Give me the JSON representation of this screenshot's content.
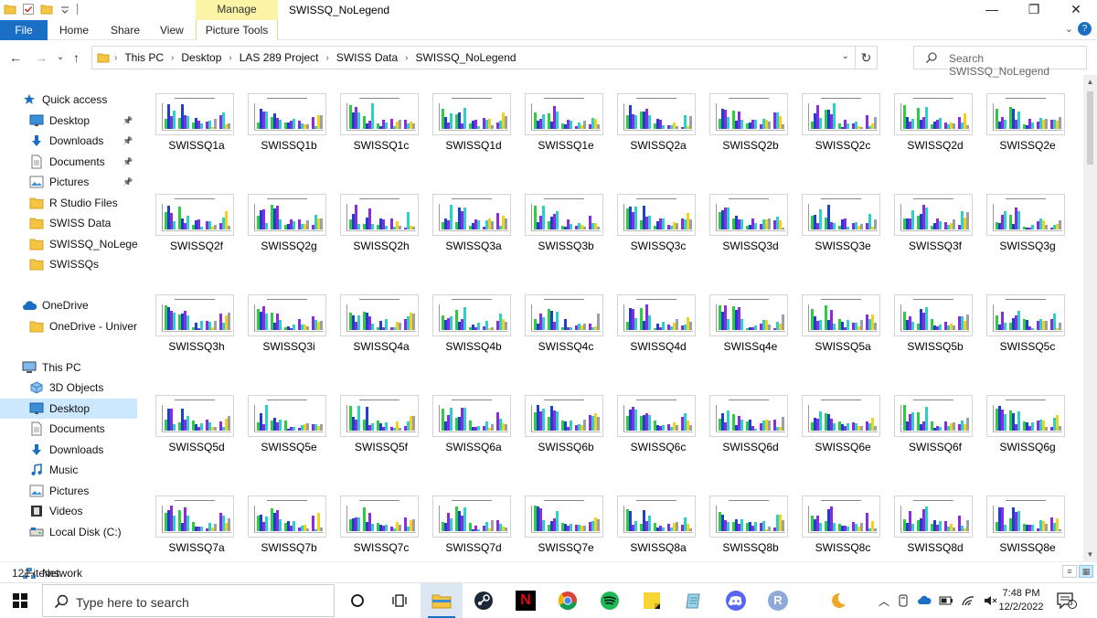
{
  "window": {
    "title": "SWISSQ_NoLegend",
    "context_tab": "Manage",
    "controls": {
      "minimize": "—",
      "maximize": "❐",
      "close": "✕"
    }
  },
  "ribbon": {
    "tabs": [
      "File",
      "Home",
      "Share",
      "View",
      "Picture Tools"
    ],
    "expand": "⌄",
    "help": "?"
  },
  "nav": {
    "back": "←",
    "forward": "→",
    "recent": "⌄",
    "up": "↑",
    "breadcrumb": [
      "This PC",
      "Desktop",
      "LAS 289 Project",
      "SWISS Data",
      "SWISSQ_NoLegend"
    ],
    "separator": "›",
    "dropdown": "⌄",
    "refresh": "↻"
  },
  "search": {
    "placeholder": "Search SWISSQ_NoLegend"
  },
  "sidebar": {
    "items": [
      {
        "label": "Quick access",
        "icon": "star-icon",
        "level": 0,
        "pinned": false,
        "selected": false
      },
      {
        "label": "Desktop",
        "icon": "desktop-icon",
        "level": 1,
        "pinned": true,
        "selected": false
      },
      {
        "label": "Downloads",
        "icon": "download-arrow-icon",
        "level": 1,
        "pinned": true,
        "selected": false
      },
      {
        "label": "Documents",
        "icon": "documents-icon",
        "level": 1,
        "pinned": true,
        "selected": false
      },
      {
        "label": "Pictures",
        "icon": "pictures-icon",
        "level": 1,
        "pinned": true,
        "selected": false
      },
      {
        "label": "R Studio Files",
        "icon": "folder-icon",
        "level": 1,
        "pinned": false,
        "selected": false
      },
      {
        "label": "SWISS Data",
        "icon": "folder-icon",
        "level": 1,
        "pinned": false,
        "selected": false
      },
      {
        "label": "SWISSQ_NoLegend",
        "icon": "folder-icon",
        "level": 1,
        "pinned": false,
        "selected": false
      },
      {
        "label": "SWISSQs",
        "icon": "folder-icon",
        "level": 1,
        "pinned": false,
        "selected": false
      },
      {
        "label": "OneDrive",
        "icon": "cloud-icon",
        "level": 0,
        "pinned": false,
        "selected": false
      },
      {
        "label": "OneDrive - Universi",
        "icon": "folder-icon",
        "level": 1,
        "pinned": false,
        "selected": false
      },
      {
        "label": "This PC",
        "icon": "computer-icon",
        "level": 0,
        "pinned": false,
        "selected": false
      },
      {
        "label": "3D Objects",
        "icon": "cube-icon",
        "level": 1,
        "pinned": false,
        "selected": false
      },
      {
        "label": "Desktop",
        "icon": "desktop-icon",
        "level": 1,
        "pinned": false,
        "selected": true
      },
      {
        "label": "Documents",
        "icon": "documents-icon",
        "level": 1,
        "pinned": false,
        "selected": false
      },
      {
        "label": "Downloads",
        "icon": "download-arrow-icon",
        "level": 1,
        "pinned": false,
        "selected": false
      },
      {
        "label": "Music",
        "icon": "music-note-icon",
        "level": 1,
        "pinned": false,
        "selected": false
      },
      {
        "label": "Pictures",
        "icon": "pictures-icon",
        "level": 1,
        "pinned": false,
        "selected": false
      },
      {
        "label": "Videos",
        "icon": "film-icon",
        "level": 1,
        "pinned": false,
        "selected": false
      },
      {
        "label": "Local Disk (C:)",
        "icon": "drive-icon",
        "level": 1,
        "pinned": false,
        "selected": false
      },
      {
        "label": "Network",
        "icon": "network-icon",
        "level": 0,
        "pinned": false,
        "selected": false
      }
    ]
  },
  "files": [
    "SWISSQ1a",
    "SWISSQ1b",
    "SWISSQ1c",
    "SWISSQ1d",
    "SWISSQ1e",
    "SWISSQ2a",
    "SWISSQ2b",
    "SWISSQ2c",
    "SWISSQ2d",
    "SWISSQ2e",
    "SWISSQ2f",
    "SWISSQ2g",
    "SWISSQ2h",
    "SWISSQ3a",
    "SWISSQ3b",
    "SWISSQ3c",
    "SWISSQ3d",
    "SWISSQ3e",
    "SWISSQ3f",
    "SWISSQ3g",
    "SWISSQ3h",
    "SWISSQ3i",
    "SWISSQ4a",
    "SWISSQ4b",
    "SWISSQ4c",
    "SWISSQ4d",
    "SWISSq4e",
    "SWISSQ5a",
    "SWISSQ5b",
    "SWISSQ5c",
    "SWISSQ5d",
    "SWISSQ5e",
    "SWISSQ5f",
    "SWISSQ6a",
    "SWISSQ6b",
    "SWISSQ6c",
    "SWISSQ6d",
    "SWISSQ6e",
    "SWISSQ6f",
    "SWISSQ6g",
    "SWISSQ7a",
    "SWISSQ7b",
    "SWISSQ7c",
    "SWISSQ7d",
    "SWISSQ7e",
    "SWISSQ8a",
    "SWISSQ8b",
    "SWISSQ8c",
    "SWISSQ8d",
    "SWISSQ8e"
  ],
  "thumbnail_bar_colors": [
    "#2ecc40",
    "#1f3fd1",
    "#8a2be2",
    "#2bd1c8",
    "#f2d21b",
    "#9aa0a6"
  ],
  "status": {
    "item_count": "121 items"
  },
  "taskbar": {
    "search_placeholder": "Type here to search",
    "apps": [
      "cortana-circle-icon",
      "task-view-icon",
      "file-explorer-icon",
      "steam-icon",
      "netflix-icon",
      "chrome-icon",
      "spotify-icon",
      "sticky-notes-icon",
      "notepad-icon",
      "discord-icon",
      "r-icon"
    ],
    "clock_time": "7:48 PM",
    "clock_date": "12/2/2022",
    "notification_count": "3",
    "r_glyph": "R",
    "netflix_glyph": "N"
  }
}
